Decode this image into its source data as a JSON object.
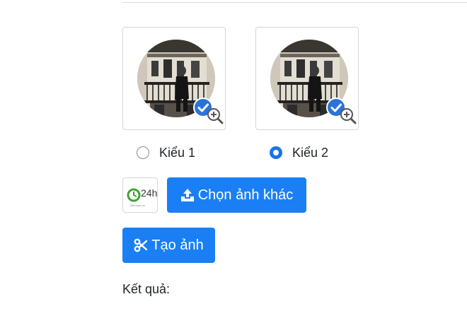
{
  "styles": {
    "options": [
      {
        "label": "Kiểu 1",
        "checked": false
      },
      {
        "label": "Kiểu 2",
        "checked": true
      }
    ],
    "preview_icons": {
      "badge": "check-badge-icon",
      "zoom": "zoom-in-icon"
    }
  },
  "logo": {
    "text": "24h",
    "subtext": "24h.com.vn"
  },
  "actions": {
    "choose_label": "Chọn ảnh khác",
    "choose_icon": "upload-icon",
    "create_label": "Tạo ảnh",
    "create_icon": "scissors-icon"
  },
  "result": {
    "label": "Kết quả:"
  },
  "colors": {
    "primary": "#1a7ff5",
    "radio_checked": "#1a73e8",
    "logo_green": "#3fa535"
  }
}
